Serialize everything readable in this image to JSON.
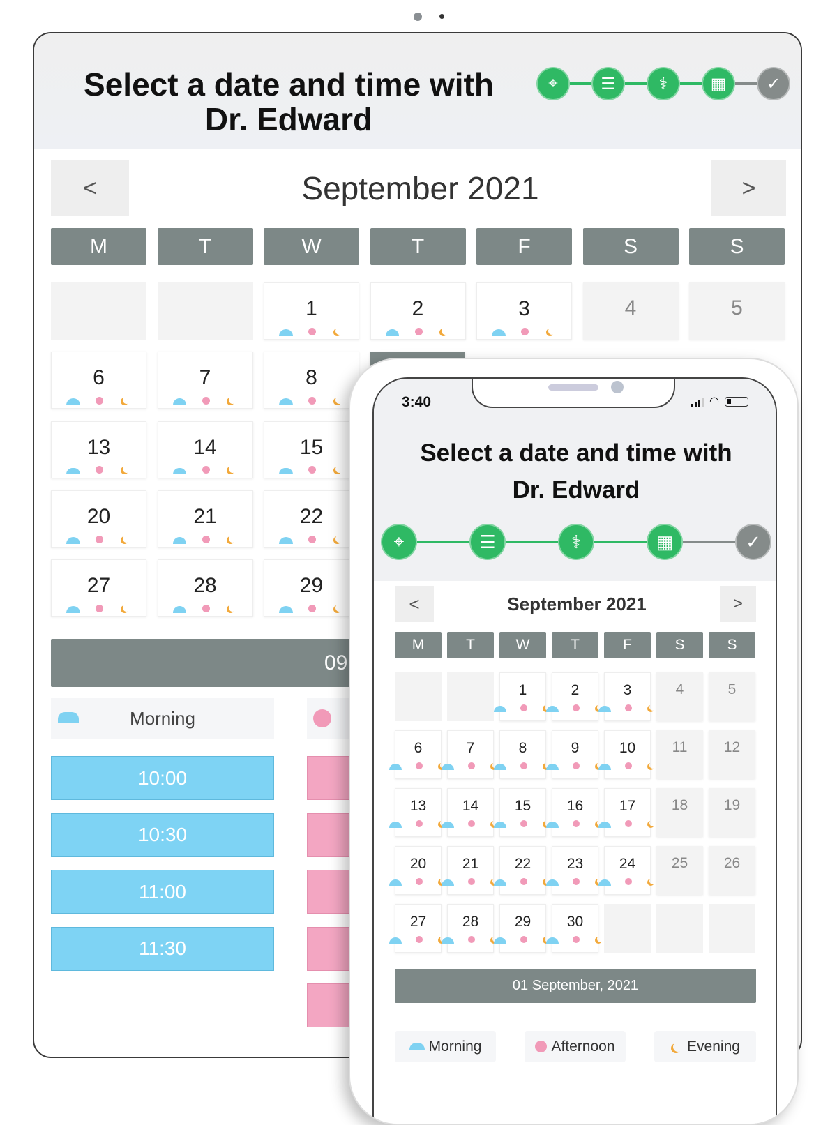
{
  "colors": {
    "green": "#2fb964",
    "gray": "#858b8a",
    "morning": "#7fd2f2",
    "afternoon": "#f19ab8",
    "evening": "#f2a93b"
  },
  "steps": [
    {
      "icon": "location-pin-icon",
      "done": false
    },
    {
      "icon": "document-list-icon",
      "done": false
    },
    {
      "icon": "stethoscope-icon",
      "done": false
    },
    {
      "icon": "calendar-icon",
      "done": false
    },
    {
      "icon": "check-circle-icon",
      "done": true
    }
  ],
  "tablet": {
    "title_line1": "Select a date and time with",
    "title_line2": "Dr. Edward",
    "prev": "<",
    "next": ">",
    "month": "September 2021",
    "weekdays": [
      "M",
      "T",
      "W",
      "T",
      "F",
      "S",
      "S"
    ],
    "rows": [
      [
        "",
        "",
        "1",
        "2",
        "3",
        "4",
        "5"
      ],
      [
        "6",
        "7",
        "8"
      ],
      [
        "13",
        "14",
        "15"
      ],
      [
        "20",
        "21",
        "22"
      ],
      [
        "27",
        "28",
        "29"
      ]
    ],
    "date_bar": "09",
    "morning_label": "Morning",
    "morning_slots": [
      "10:00",
      "10:30",
      "11:00",
      "11:30"
    ]
  },
  "phone": {
    "time": "3:40",
    "title_line1": "Select a date and time with",
    "title_line2": "Dr. Edward",
    "prev": "<",
    "next": ">",
    "month": "September 2021",
    "weekdays": [
      "M",
      "T",
      "W",
      "T",
      "F",
      "S",
      "S"
    ],
    "rows": [
      [
        "",
        "",
        "1",
        "2",
        "3",
        "4",
        "5"
      ],
      [
        "6",
        "7",
        "8",
        "9",
        "10",
        "11",
        "12"
      ],
      [
        "13",
        "14",
        "15",
        "16",
        "17",
        "18",
        "19"
      ],
      [
        "20",
        "21",
        "22",
        "23",
        "24",
        "25",
        "26"
      ],
      [
        "27",
        "28",
        "29",
        "30",
        "",
        "",
        ""
      ]
    ],
    "date_bar": "01 September, 2021",
    "legend": {
      "morning": "Morning",
      "afternoon": "Afternoon",
      "evening": "Evening"
    }
  }
}
